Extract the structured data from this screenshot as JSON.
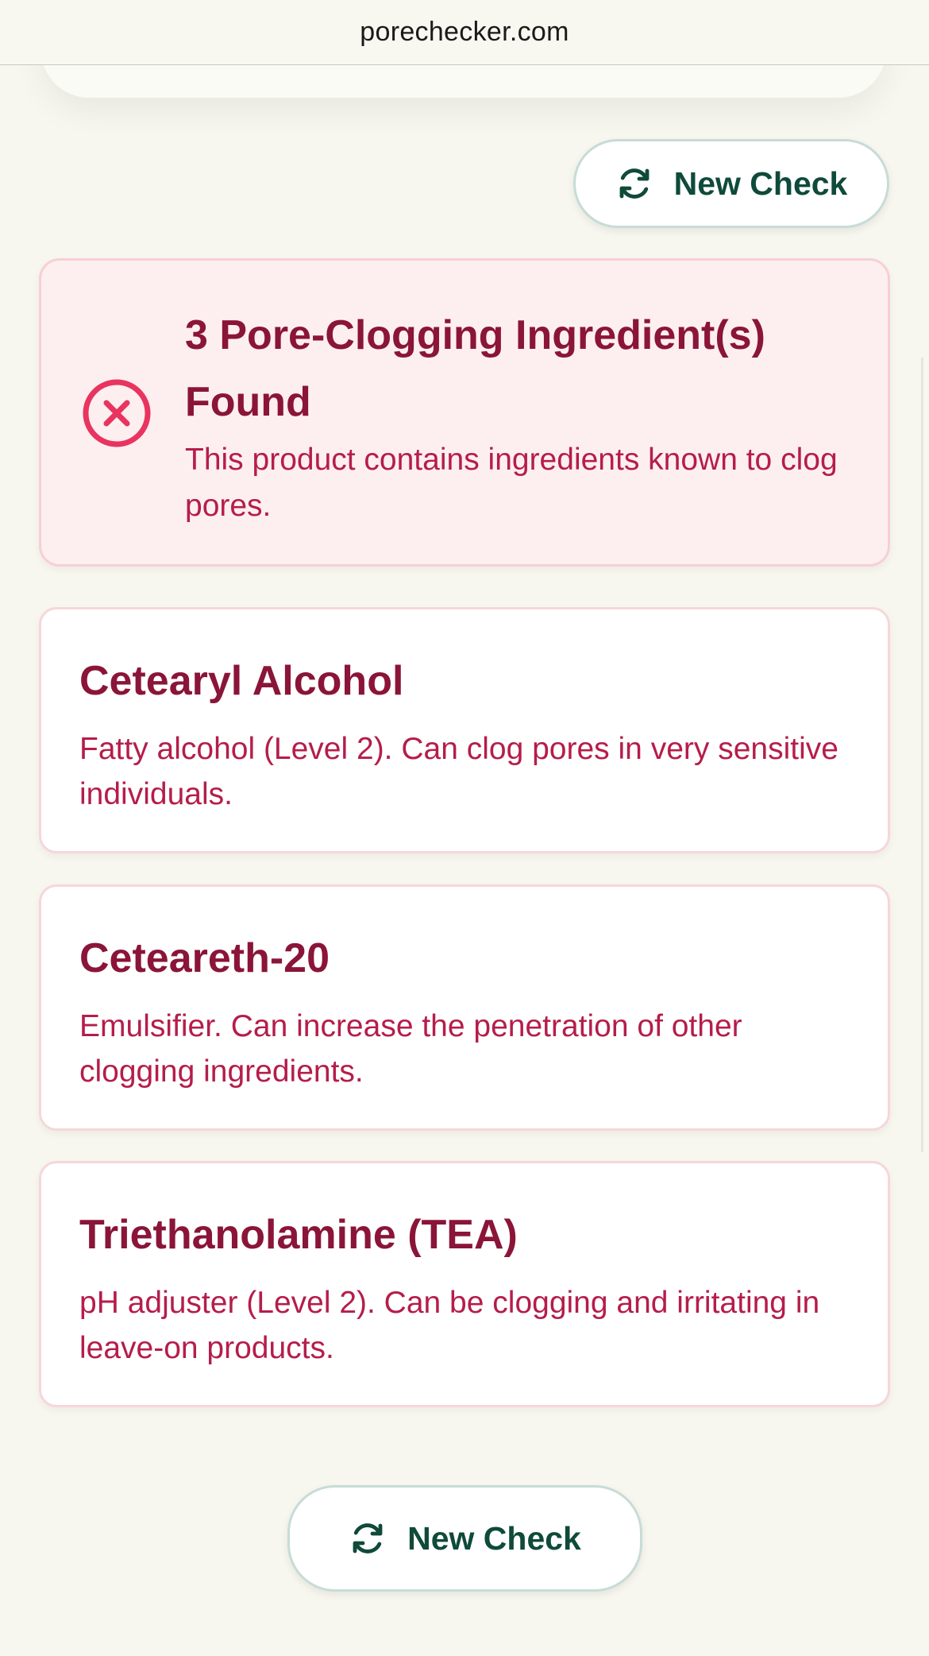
{
  "browser": {
    "url": "porechecker.com"
  },
  "actions": {
    "new_check_label": "New Check"
  },
  "alert": {
    "title": "3 Pore-Clogging Ingredient(s) Found",
    "description": "This product contains ingredients known to clog pores.",
    "status_color": "#e8345f"
  },
  "ingredients": [
    {
      "name": "Cetearyl Alcohol",
      "description": "Fatty alcohol (Level 2). Can clog pores in very sensitive individuals."
    },
    {
      "name": "Ceteareth-20",
      "description": "Emulsifier. Can increase the penetration of other clogging ingredients."
    },
    {
      "name": "Triethanolamine (TEA)",
      "description": "pH adjuster (Level 2). Can be clogging and irritating in leave-on products."
    }
  ],
  "colors": {
    "background": "#f7f7f0",
    "button_text": "#0f4a3a",
    "heading": "#8a1538",
    "body_text": "#b51d4a",
    "alert_bg": "#fdeff0"
  }
}
